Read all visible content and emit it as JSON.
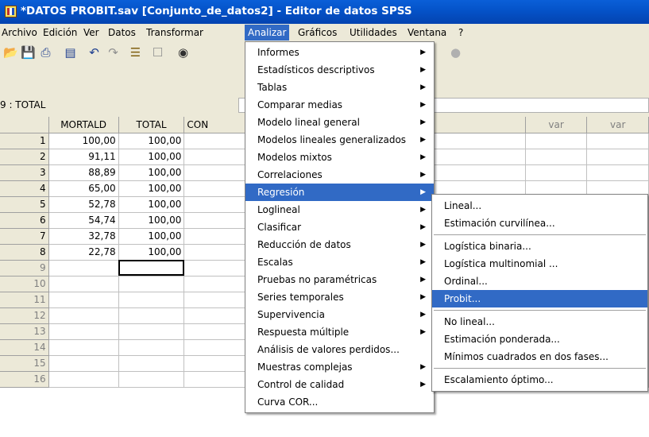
{
  "window": {
    "title": "*DATOS PROBIT.sav [Conjunto_de_datos2] - Editor de datos SPSS"
  },
  "menubar": [
    "Archivo",
    "Edición",
    "Ver",
    "Datos",
    "Transformar",
    "Analizar",
    "Gráficos",
    "Utilidades",
    "Ventana",
    "?"
  ],
  "toolbar": {
    "icons": [
      "open-icon",
      "save-icon",
      "print-icon",
      "dialog-recall-icon",
      "undo-icon",
      "redo-icon",
      "goto-case-icon",
      "variables-icon",
      "find-icon"
    ]
  },
  "cell_reference": "9 : TOTAL",
  "grid": {
    "columns": [
      "MORTALD",
      "TOTAL",
      "CON",
      "var",
      "var",
      "var"
    ],
    "row_numbers": [
      "1",
      "2",
      "3",
      "4",
      "5",
      "6",
      "7",
      "8",
      "9",
      "10",
      "11",
      "12",
      "13",
      "14",
      "15",
      "16"
    ],
    "rows": [
      [
        "100,00",
        "100,00"
      ],
      [
        "91,11",
        "100,00"
      ],
      [
        "88,89",
        "100,00"
      ],
      [
        "65,00",
        "100,00"
      ],
      [
        "52,78",
        "100,00"
      ],
      [
        "54,74",
        "100,00"
      ],
      [
        "32,78",
        "100,00"
      ],
      [
        "22,78",
        "100,00"
      ]
    ]
  },
  "analizar_menu": {
    "items": [
      {
        "label": "Informes",
        "submenu": true
      },
      {
        "label": "Estadísticos descriptivos",
        "submenu": true
      },
      {
        "label": "Tablas",
        "submenu": true
      },
      {
        "label": "Comparar medias",
        "submenu": true
      },
      {
        "label": "Modelo lineal general",
        "submenu": true
      },
      {
        "label": "Modelos lineales generalizados",
        "submenu": true
      },
      {
        "label": "Modelos mixtos",
        "submenu": true
      },
      {
        "label": "Correlaciones",
        "submenu": true
      },
      {
        "label": "Regresión",
        "submenu": true,
        "highlighted": true
      },
      {
        "label": "Loglineal",
        "submenu": true
      },
      {
        "label": "Clasificar",
        "submenu": true
      },
      {
        "label": "Reducción de datos",
        "submenu": true
      },
      {
        "label": "Escalas",
        "submenu": true
      },
      {
        "label": "Pruebas no paramétricas",
        "submenu": true
      },
      {
        "label": "Series temporales",
        "submenu": true
      },
      {
        "label": "Supervivencia",
        "submenu": true
      },
      {
        "label": "Respuesta múltiple",
        "submenu": true
      },
      {
        "label": "Análisis de valores perdidos...",
        "submenu": false
      },
      {
        "label": "Muestras complejas",
        "submenu": true
      },
      {
        "label": "Control de calidad",
        "submenu": true
      },
      {
        "label": "Curva COR...",
        "submenu": false
      }
    ]
  },
  "regresion_submenu": {
    "groups": [
      [
        "Lineal...",
        "Estimación curvilínea..."
      ],
      [
        "Logística binaria...",
        "Logística multinomial ...",
        "Ordinal...",
        "Probit..."
      ],
      [
        "No lineal...",
        "Estimación ponderada...",
        "Mínimos cuadrados en dos fases..."
      ],
      [
        "Escalamiento óptimo..."
      ]
    ],
    "highlighted": "Probit..."
  },
  "colors": {
    "title_bar": "#0452c8",
    "highlight": "#316ac5",
    "chrome": "#ece9d8"
  }
}
